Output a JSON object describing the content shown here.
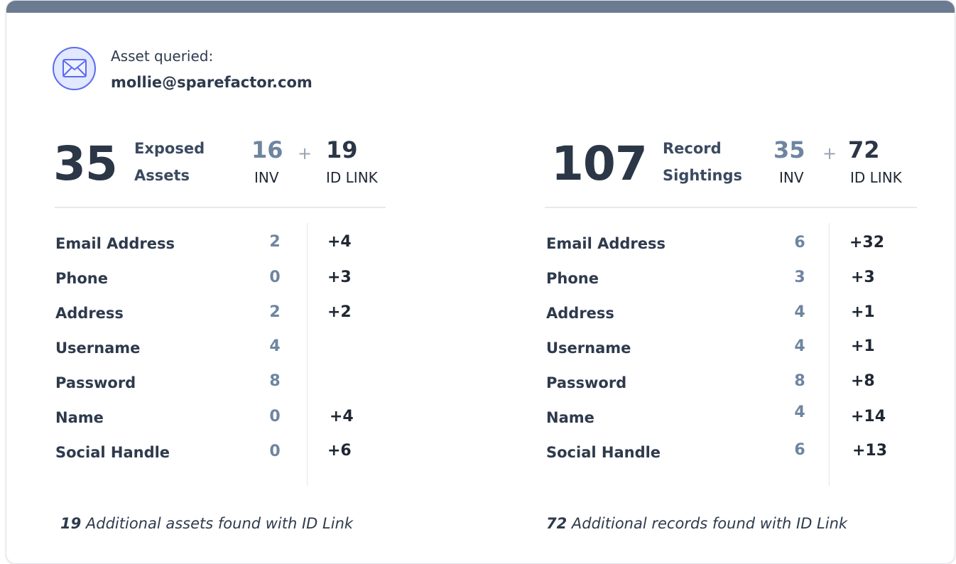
{
  "asset": {
    "label": "Asset queried:",
    "value": "mollie@sparefactor.com",
    "icon": "envelope-icon"
  },
  "exposed": {
    "total": "35",
    "label_line1": "Exposed",
    "label_line2": "Assets",
    "inv_count": "16",
    "plus": "+",
    "id_count": "19",
    "inv_caption": "INV",
    "id_caption": "ID LINK",
    "rows": [
      {
        "label": "Email Address",
        "inv": "2",
        "id": "+4"
      },
      {
        "label": "Phone",
        "inv": "0",
        "id": "+3"
      },
      {
        "label": "Address",
        "inv": "2",
        "id": "+2"
      },
      {
        "label": "Username",
        "inv": "4",
        "id": ""
      },
      {
        "label": "Password",
        "inv": "8",
        "id": ""
      },
      {
        "label": "Name",
        "inv": "0",
        "id": "+4"
      },
      {
        "label": "Social Handle",
        "inv": "0",
        "id": "+6"
      }
    ],
    "footer_count": "19",
    "footer_text": " Additional assets found with ID Link"
  },
  "records": {
    "total": "107",
    "label_line1": "Record",
    "label_line2": "Sightings",
    "inv_count": "35",
    "plus": "+",
    "id_count": "72",
    "inv_caption": "INV",
    "id_caption": "ID LINK",
    "rows": [
      {
        "label": "Email Address",
        "inv": "6",
        "id": "+32"
      },
      {
        "label": "Phone",
        "inv": "3",
        "id": "+3"
      },
      {
        "label": "Address",
        "inv": "4",
        "id": "+1"
      },
      {
        "label": "Username",
        "inv": "4",
        "id": "+1"
      },
      {
        "label": "Password",
        "inv": "8",
        "id": "+8"
      },
      {
        "label": "Name",
        "inv": "4",
        "id": "+14"
      },
      {
        "label": "Social Handle",
        "inv": "6",
        "id": "+13"
      }
    ],
    "footer_count": "72",
    "footer_text": " Additional records found with ID Link"
  },
  "colors": {
    "topbar": "#6b7b91",
    "inv_accent": "#6e85a0",
    "icon_ring": "#5b6cf0",
    "icon_bg": "#e2e8fd"
  }
}
